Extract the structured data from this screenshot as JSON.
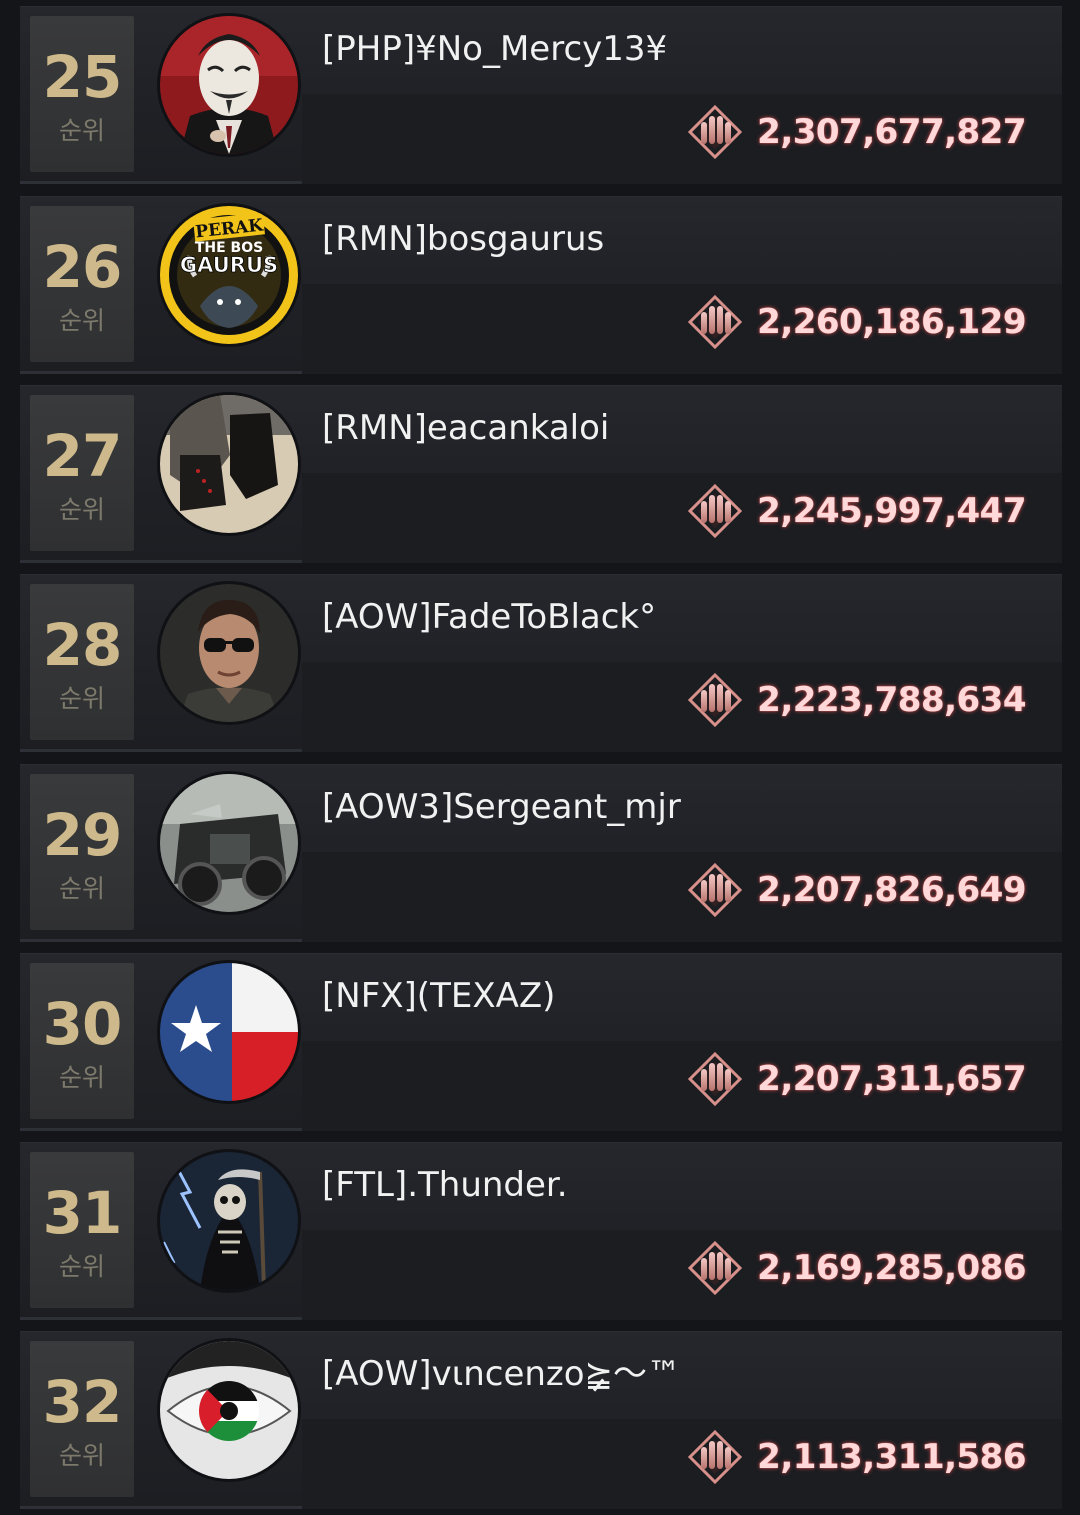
{
  "rank_suffix": "순위",
  "entries": [
    {
      "rank": "25",
      "name": "[PHP]¥No_Mercy13¥",
      "score": "2,307,677,827",
      "avatar": "masked-man-avatar"
    },
    {
      "rank": "26",
      "name": "[RMN]bosgaurus",
      "score": "2,260,186,129",
      "avatar": "bull-logo-avatar",
      "avatar_text": "PERAK THE BOS GAURUS"
    },
    {
      "rank": "27",
      "name": "[RMN]eacankaloi",
      "score": "2,245,997,447",
      "avatar": "boots-photo-avatar"
    },
    {
      "rank": "28",
      "name": "[AOW]FadeToBlack°",
      "score": "2,223,788,634",
      "avatar": "sunglasses-man-avatar"
    },
    {
      "rank": "29",
      "name": "[AOW3]Sergeant_mjr",
      "score": "2,207,826,649",
      "avatar": "motorcycle-avatar"
    },
    {
      "rank": "30",
      "name": "[NFX](TEXAZ)",
      "score": "2,207,311,657",
      "avatar": "texas-flag-avatar"
    },
    {
      "rank": "31",
      "name": "[FTL].Thunder.",
      "score": "2,169,285,086",
      "avatar": "grim-reaper-avatar"
    },
    {
      "rank": "32",
      "name": "[AOW]vιncenzo⪶〜™",
      "score": "2,113,311,586",
      "avatar": "eye-flag-avatar"
    }
  ],
  "colors": {
    "rank_number": "#cdb98b",
    "rank_label": "#7d7a6c",
    "score_glow": "#ff6a6a",
    "row_bg": "#1f2126"
  },
  "icons": {
    "score": "bullets-emblem-icon"
  }
}
